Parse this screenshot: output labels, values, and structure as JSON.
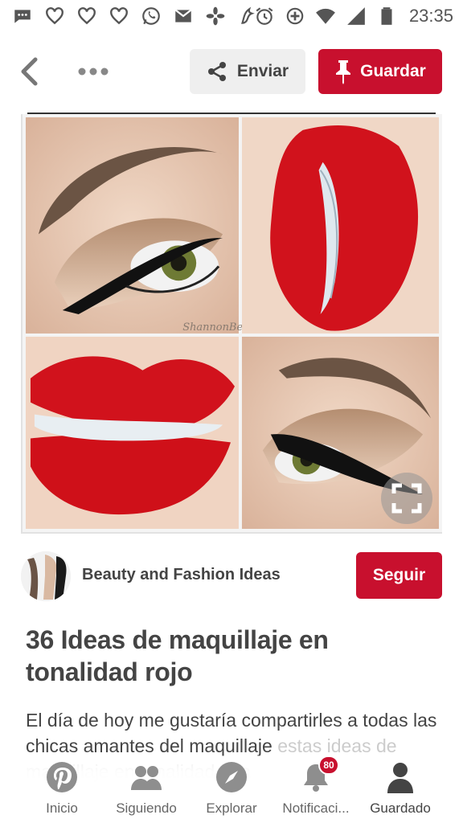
{
  "status_bar": {
    "time": "23:35",
    "left_icons": [
      "message-icon",
      "heart-icon",
      "heart-icon",
      "heart-icon",
      "whatsapp-icon",
      "gmail-icon",
      "pinwheel-icon",
      "bird-icon"
    ],
    "right_icons": [
      "alarm-icon",
      "data-saver-icon",
      "wifi-icon",
      "signal-icon",
      "battery-icon"
    ]
  },
  "toolbar": {
    "share_label": "Enviar",
    "save_label": "Guardar"
  },
  "pin": {
    "image_watermark": "ShannonBelleMakeup",
    "board_name": "Beauty and Fashion Ideas",
    "follow_label": "Seguir",
    "title": "36 Ideas de maquillaje en tonalidad rojo",
    "description": "El día de hoy me gustaría compartirles a todas las chicas amantes del maquillaje",
    "description_faded": "estas ideas de maquillaje en tonalidad roja"
  },
  "bottom_nav": {
    "items": [
      {
        "label": "Inicio",
        "icon": "pinterest-icon"
      },
      {
        "label": "Siguiendo",
        "icon": "people-icon"
      },
      {
        "label": "Explorar",
        "icon": "compass-icon"
      },
      {
        "label": "Notificaci...",
        "icon": "bell-icon",
        "badge": "80"
      },
      {
        "label": "Guardado",
        "icon": "person-icon",
        "active": true
      }
    ]
  },
  "colors": {
    "brand_red": "#c8102e",
    "text_dark": "#444444",
    "lip_red": "#d1121c"
  }
}
